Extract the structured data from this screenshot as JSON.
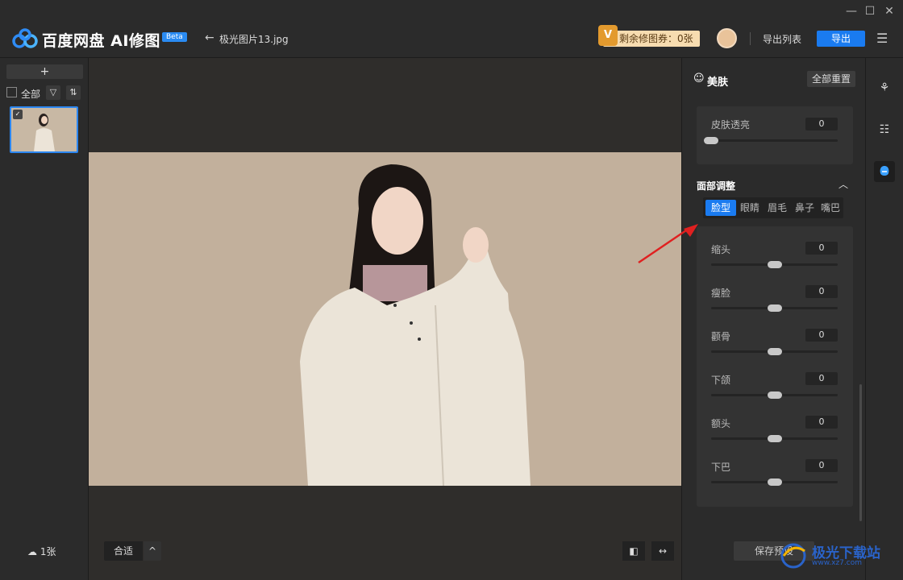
{
  "app": {
    "title": "百度网盘 AI修图",
    "beta": "Beta",
    "file_name": "极光图片13.jpg",
    "coupon": "剩余修图券：0张",
    "coupon_badge": "V",
    "export_list": "导出列表",
    "export": "导出"
  },
  "left": {
    "add": "+",
    "select_all": "全部",
    "photo_count": "1张"
  },
  "canvas": {
    "fit": "合适",
    "fit_arrow": "^"
  },
  "panel": {
    "title": "美肤",
    "reset_all": "全部重置",
    "skin_sliders": [
      {
        "label": "皮肤透亮",
        "value": "0",
        "position": 0.0
      }
    ],
    "face_section_title": "面部调整",
    "tabs": [
      {
        "label": "脸型",
        "active": true
      },
      {
        "label": "眼睛",
        "active": false
      },
      {
        "label": "眉毛",
        "active": false
      },
      {
        "label": "鼻子",
        "active": false
      },
      {
        "label": "嘴巴",
        "active": false
      }
    ],
    "face_sliders": [
      {
        "label": "缩头",
        "value": "0",
        "position": 0.5
      },
      {
        "label": "瘦脸",
        "value": "0",
        "position": 0.5
      },
      {
        "label": "颧骨",
        "value": "0",
        "position": 0.5
      },
      {
        "label": "下颌",
        "value": "0",
        "position": 0.5
      },
      {
        "label": "额头",
        "value": "0",
        "position": 0.5
      },
      {
        "label": "下巴",
        "value": "0",
        "position": 0.5
      }
    ],
    "save_preset": "保存预设"
  },
  "watermark": {
    "title": "极光下载站",
    "url": "www.xz7.com"
  },
  "colors": {
    "accent": "#1a7bf0",
    "background": "#262626",
    "photo_background": "#c2b09c"
  }
}
